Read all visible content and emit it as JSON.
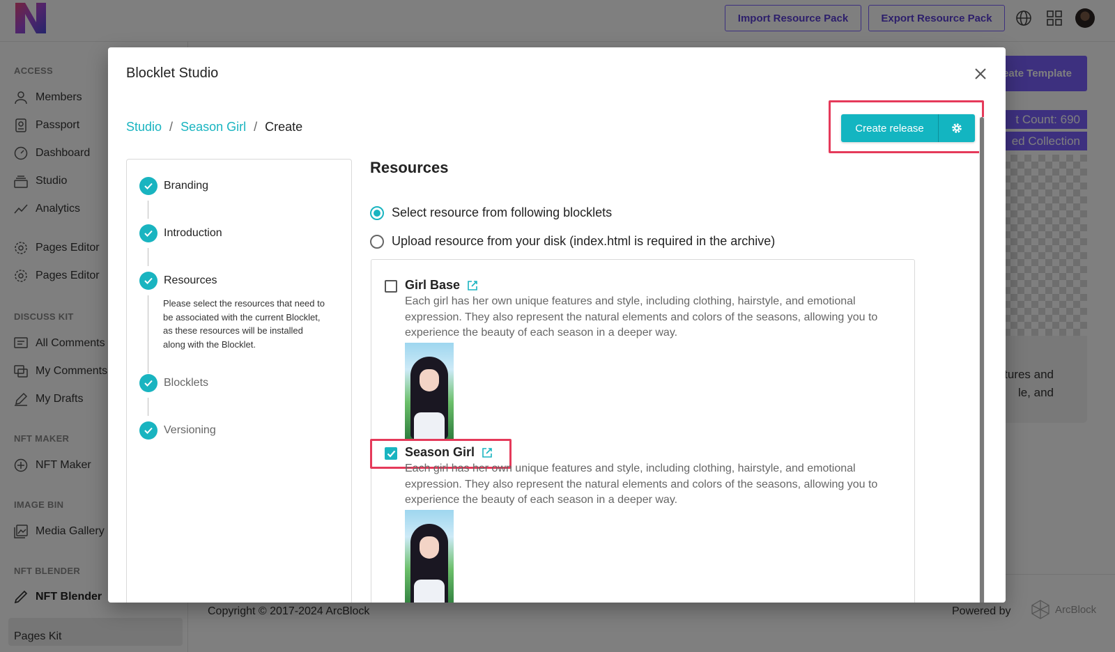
{
  "header": {
    "import_label": "Import Resource Pack",
    "export_label": "Export Resource Pack"
  },
  "sidebar": {
    "groups": [
      {
        "title": "ACCESS",
        "items": [
          "Members",
          "Passport",
          "Dashboard",
          "Studio",
          "Analytics"
        ]
      },
      {
        "title": "",
        "items": [
          "Pages Editor",
          "Pages Editor"
        ]
      },
      {
        "title": "DISCUSS KIT",
        "items": [
          "All Comments",
          "My Comments",
          "My Drafts"
        ]
      },
      {
        "title": "NFT MAKER",
        "items": [
          "NFT Maker"
        ]
      },
      {
        "title": "IMAGE BIN",
        "items": [
          "Media Gallery"
        ]
      },
      {
        "title": "NFT BLENDER",
        "items": [
          "NFT Blender"
        ]
      }
    ],
    "pages_kit": "Pages Kit"
  },
  "background": {
    "create_template": "eate Template",
    "count_tag": "t Count: 690",
    "collection_tag": "ed Collection",
    "card_text_line1": "atures and",
    "card_text_line2": "le, and",
    "copyright": "Copyright © 2017-2024  ArcBlock",
    "powered_by": "Powered by",
    "arcblock": "ArcBlock"
  },
  "modal": {
    "title": "Blocklet Studio",
    "breadcrumb": [
      "Studio",
      "Season Girl",
      "Create"
    ],
    "create_release": "Create release",
    "steps": [
      {
        "label": "Branding",
        "done": true
      },
      {
        "label": "Introduction",
        "done": true
      },
      {
        "label": "Resources",
        "done": true
      },
      {
        "label": "Blocklets",
        "done": true
      },
      {
        "label": "Versioning",
        "done": true
      }
    ],
    "step_description": "Please select the resources that need to be associated with the current Blocklet, as these resources will be installed along with the Blocklet.",
    "resources": {
      "title": "Resources",
      "options": [
        {
          "label": "Select resource from following blocklets",
          "selected": true
        },
        {
          "label": "Upload resource from your disk (index.html is required in the archive)",
          "selected": false
        }
      ],
      "items": [
        {
          "name": "Girl Base",
          "checked": false,
          "description": "Each girl has her own unique features and style, including clothing, hairstyle, and emotional expression. They also represent the natural elements and colors of the seasons, allowing you to experience the beauty of each season in a deeper way."
        },
        {
          "name": "Season Girl",
          "checked": true,
          "description": "Each girl has her own unique features and style, including clothing, hairstyle, and emotional expression. They also represent the natural elements and colors of the seasons, allowing you to experience the beauty of each season in a deeper way."
        }
      ]
    }
  },
  "colors": {
    "accent": "#19b4c0",
    "brand": "#7b61ff",
    "highlight": "#e53a5a"
  }
}
